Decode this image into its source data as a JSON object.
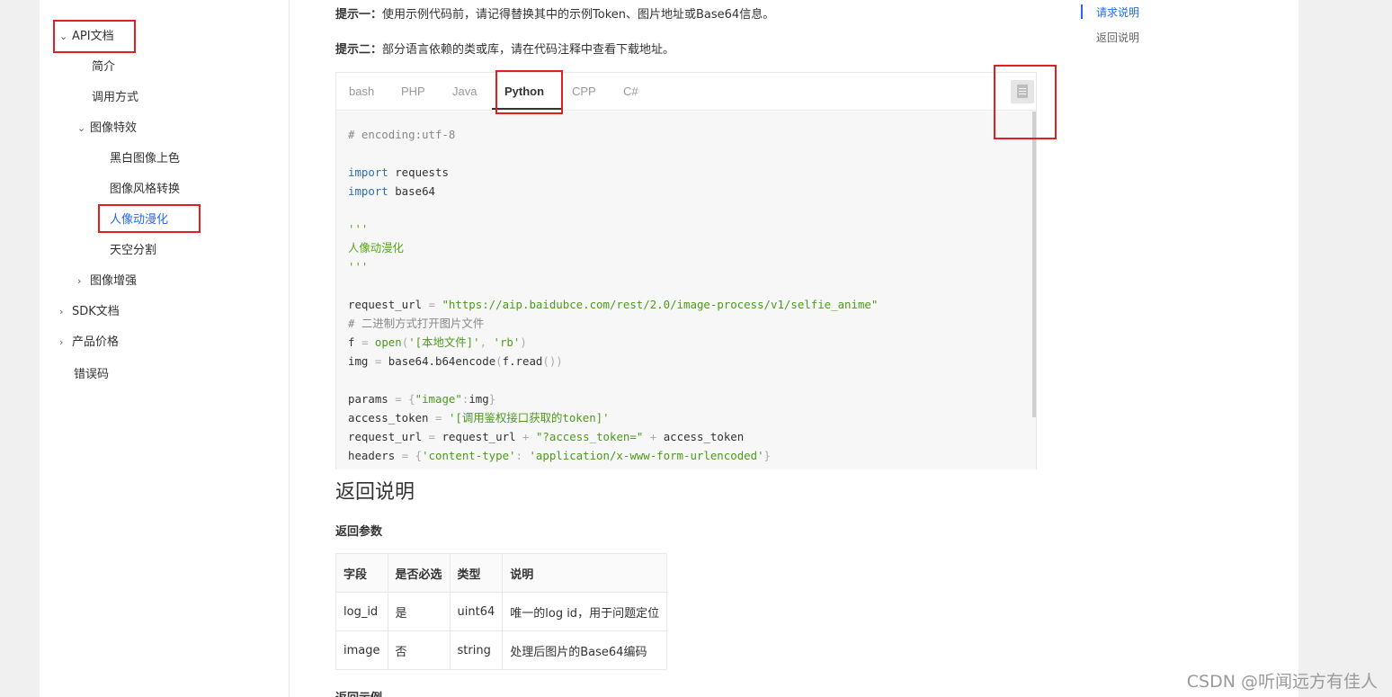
{
  "nav": {
    "api_docs": "API文档",
    "intro": "简介",
    "call_method": "调用方式",
    "image_effects": "图像特效",
    "colorize": "黑白图像上色",
    "style_transfer": "图像风格转换",
    "selfie_anime": "人像动漫化",
    "sky_seg": "天空分割",
    "image_enhance": "图像增强",
    "sdk_docs": "SDK文档",
    "pricing": "产品价格",
    "error_codes": "错误码"
  },
  "tips": {
    "tip1_label": "提示一：",
    "tip1_text": "使用示例代码前，请记得替换其中的示例Token、图片地址或Base64信息。",
    "tip2_label": "提示二：",
    "tip2_text": "部分语言依赖的类或库，请在代码注释中查看下载地址。"
  },
  "tabs": [
    "bash",
    "PHP",
    "Java",
    "Python",
    "CPP",
    "C#"
  ],
  "selected_tab": "Python",
  "code": {
    "l1": "# encoding:utf-8",
    "import_kw": "import",
    "requests": " requests",
    "base64": " base64",
    "docstring_open": "'''",
    "docstring_text": "人像动漫化",
    "docstring_close": "'''",
    "l_url_var": "request_url",
    "l_url_str": "\"https://aip.baidubce.com/rest/2.0/image-process/v1/selfie_anime\"",
    "l_cmt": "# 二进制方式打开图片文件",
    "l_f_var": "f",
    "l_f_open": "open",
    "l_f_arg1": "'[本地文件]'",
    "l_f_arg2": "'rb'",
    "l_img": "img",
    "l_img_rhs": "base64.b64encode",
    "l_img_arg": "f.read",
    "l_params": "params",
    "l_params_key": "\"image\"",
    "l_params_val": "img",
    "l_token_var": "access_token",
    "l_token_str": "'[调用鉴权接口获取的token]'",
    "l_req_var": "request_url",
    "l_req_rhs": "request_url",
    "l_req_str": "\"?access_token=\"",
    "l_req_tail": "access_token",
    "l_headers": "headers",
    "l_h_key": "'content-type'",
    "l_h_val": "'application/x-www-form-urlencoded'"
  },
  "return_section": {
    "title": "返回说明",
    "params_title": "返回参数",
    "columns": [
      "字段",
      "是否必选",
      "类型",
      "说明"
    ],
    "rows": [
      [
        "log_id",
        "是",
        "uint64",
        "唯一的log id，用于问题定位"
      ],
      [
        "image",
        "否",
        "string",
        "处理后图片的Base64编码"
      ]
    ],
    "example_title": "返回示例"
  },
  "toc": {
    "request": "请求说明",
    "response": "返回说明"
  },
  "watermark": "CSDN @听闻远方有佳人",
  "colors": {
    "accent": "#2468f2",
    "highlight_box": "#e02020"
  }
}
